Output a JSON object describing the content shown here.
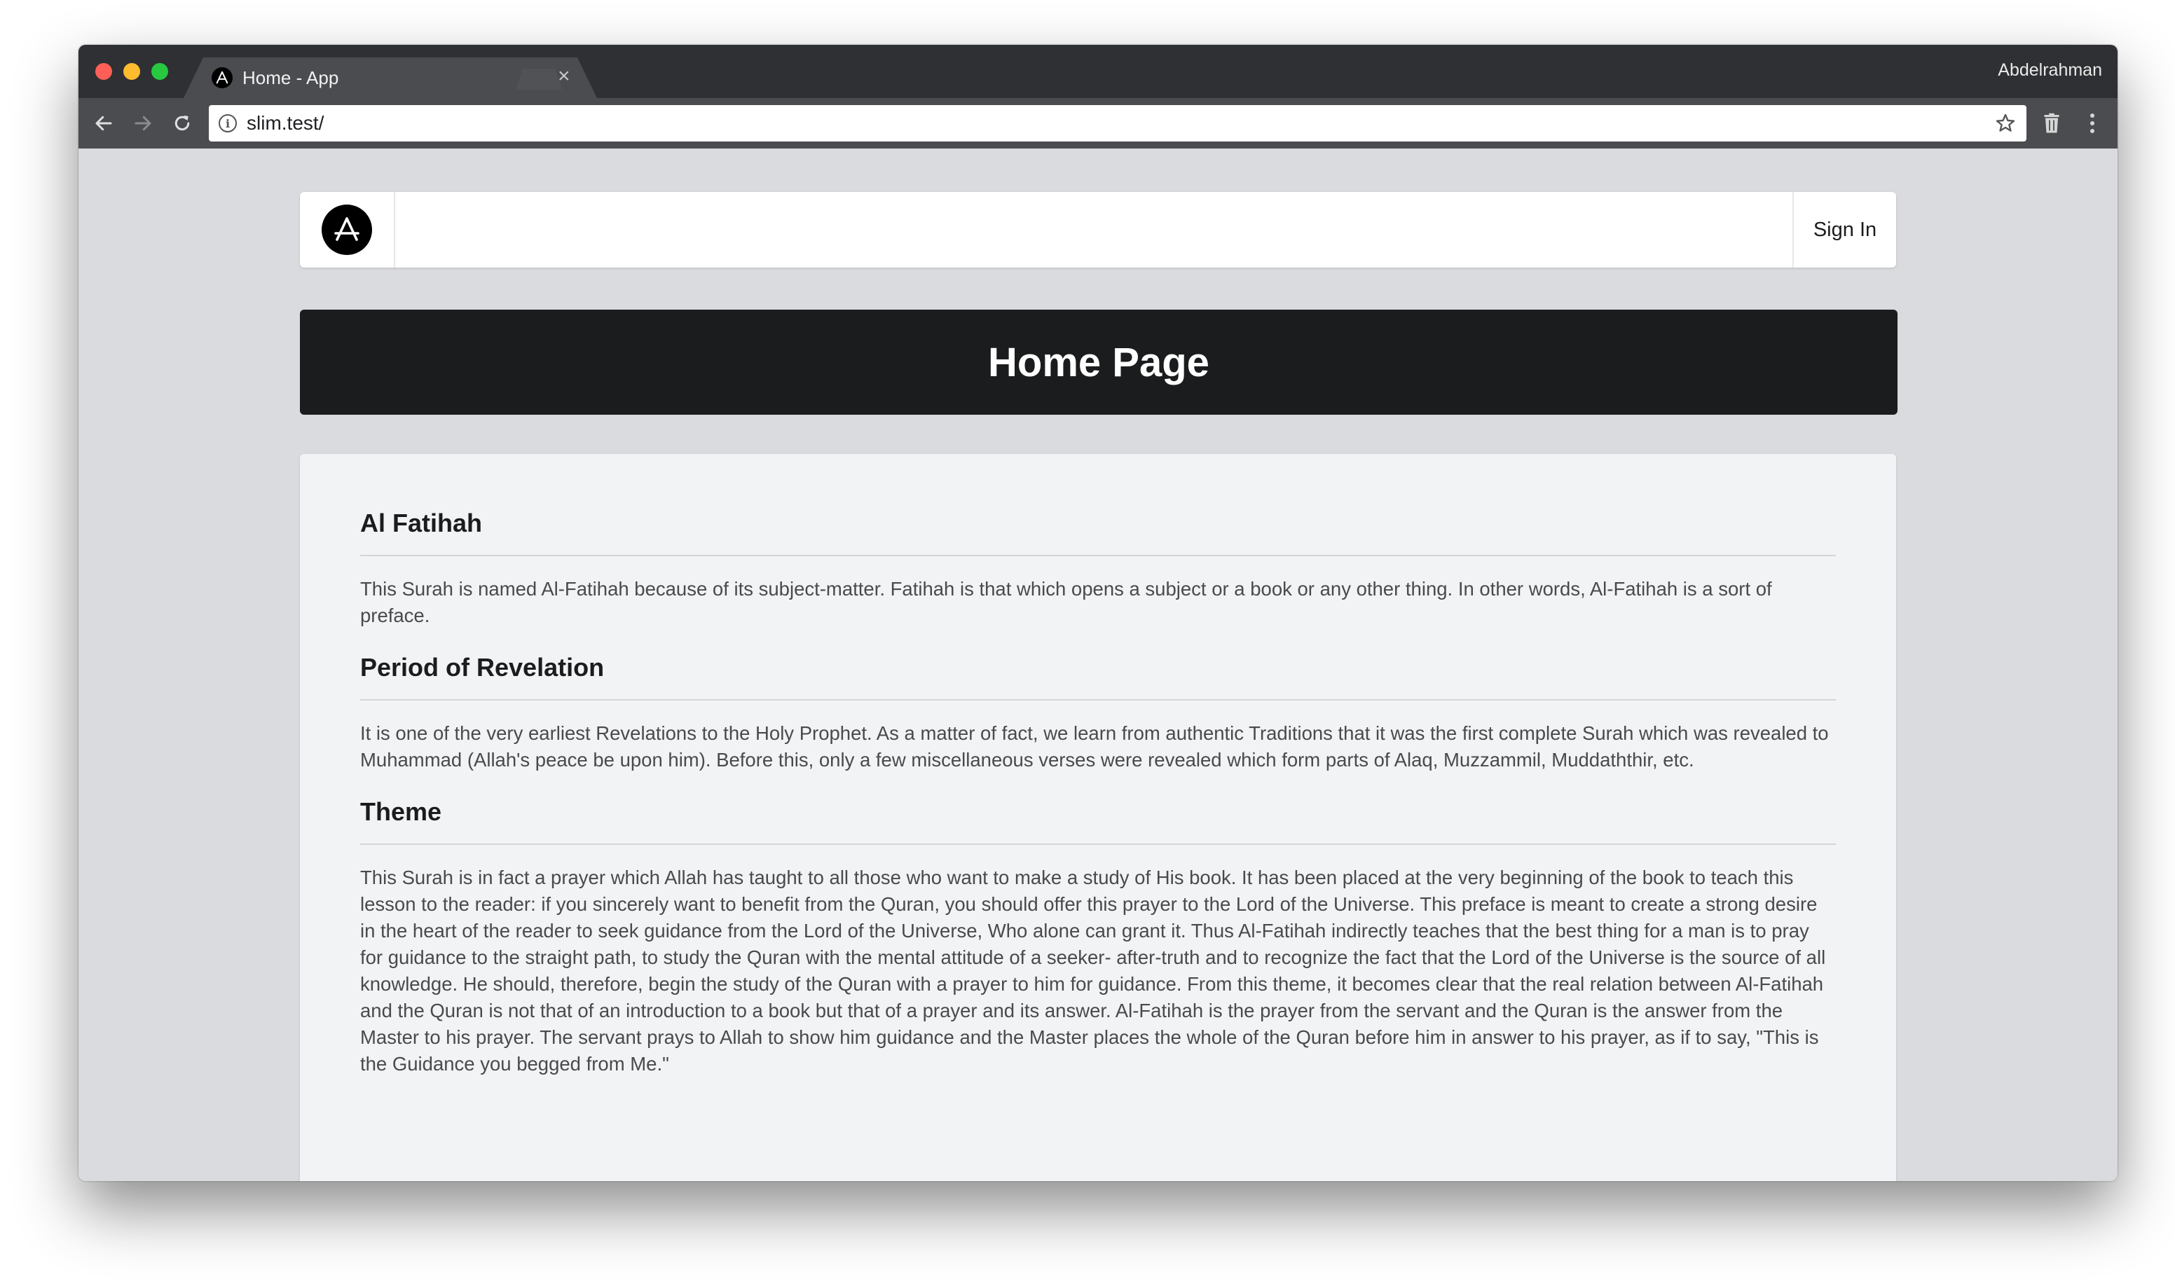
{
  "browser": {
    "tab_title": "Home - App",
    "tab_close": "×",
    "profile_name": "Abdelrahman",
    "url": "slim.test/"
  },
  "site_nav": {
    "signin_label": "Sign In"
  },
  "hero": {
    "title": "Home Page"
  },
  "sections": [
    {
      "title": "Al Fatihah",
      "body": "This Surah is named Al-Fatihah because of its subject-matter. Fatihah is that which opens a subject or a book or any other thing. In other words, Al-Fatihah is a sort of preface."
    },
    {
      "title": "Period of Revelation",
      "body": "It is one of the very earliest Revelations to the Holy Prophet. As a matter of fact, we learn from authentic Traditions that it was the first complete Surah which was revealed to Muhammad (Allah's peace be upon him). Before this, only a few miscellaneous verses were revealed which form parts of Alaq, Muzzammil, Muddaththir, etc."
    },
    {
      "title": "Theme",
      "body": "This Surah is in fact a prayer which Allah has taught to all those who want to make a study of His book. It has been placed at the very beginning of the book to teach this lesson to the reader: if you sincerely want to benefit from the Quran, you should offer this prayer to the Lord of the Universe. This preface is meant to create a strong desire in the heart of the reader to seek guidance from the Lord of the Universe, Who alone can grant it. Thus Al-Fatihah indirectly teaches that the best thing for a man is to pray for guidance to the straight path, to study the Quran with the mental attitude of a seeker- after-truth and to recognize the fact that the Lord of the Universe is the source of all knowledge. He should, therefore, begin the study of the Quran with a prayer to him for guidance. From this theme, it becomes clear that the real relation between Al-Fatihah and the Quran is not that of an introduction to a book but that of a prayer and its answer. Al-Fatihah is the prayer from the servant and the Quran is the answer from the Master to his prayer. The servant prays to Allah to show him guidance and the Master places the whole of the Quran before him in answer to his prayer, as if to say, \"This is the Guidance you begged from Me.\""
    }
  ],
  "icons": {
    "traffic_lights": [
      "close-window-icon",
      "minimize-window-icon",
      "zoom-window-icon"
    ],
    "favicon": "app-logo-icon",
    "nav": [
      "back-arrow-icon",
      "forward-arrow-icon",
      "reload-icon"
    ],
    "omnibox": [
      "info-icon",
      "star-icon"
    ],
    "toolbar_right": [
      "trash-icon",
      "kebab-menu-icon"
    ]
  },
  "colors": {
    "tabstrip": "#2e3033",
    "toolbar": "#4a4c50",
    "page_background": "#dadbde",
    "hero_background": "#1b1c1d",
    "card_background": "#f2f3f5",
    "body_text": "#4a4a4a"
  }
}
